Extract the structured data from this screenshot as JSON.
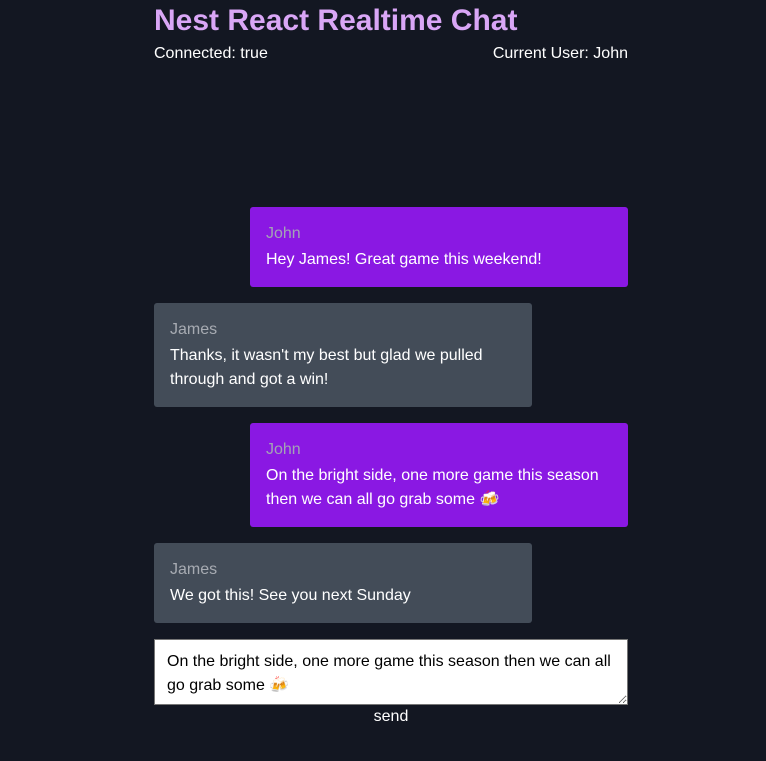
{
  "header": {
    "title": "Nest React Realtime Chat",
    "connected_label": "Connected: true",
    "current_user_label": "Current User: John"
  },
  "messages": [
    {
      "author": "John",
      "text": "Hey James! Great game this weekend!",
      "mine": true
    },
    {
      "author": "James",
      "text": "Thanks, it wasn't my best but glad we pulled through and got a win!",
      "mine": false
    },
    {
      "author": "John",
      "text": "On the bright side, one more game this season then we can all go grab some 🍻",
      "mine": true
    },
    {
      "author": "James",
      "text": "We got this! See you next Sunday",
      "mine": false
    }
  ],
  "composer": {
    "value": "On the bright side, one more game this season then we can all go grab some 🍻",
    "send_label": "send"
  },
  "colors": {
    "background": "#131722",
    "title": "#d9a6f6",
    "own_message": "#8a18e3",
    "other_message": "#434c58"
  }
}
